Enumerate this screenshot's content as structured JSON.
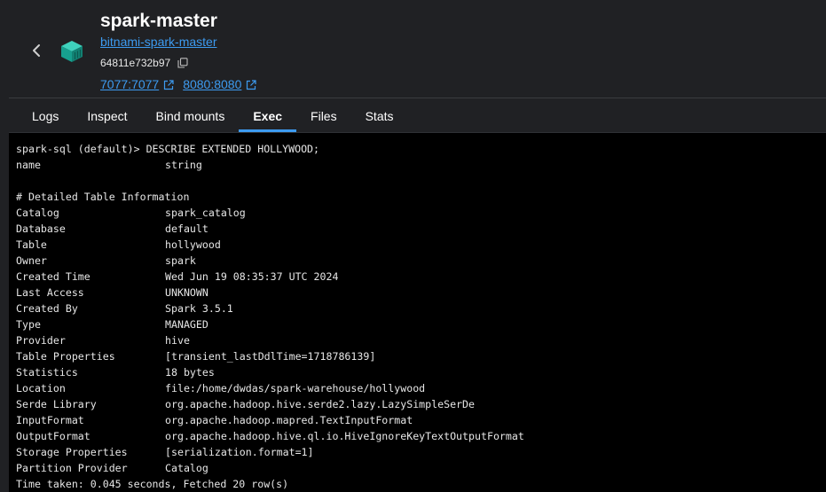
{
  "header": {
    "title": "spark-master",
    "image_link": "bitnami-spark-master",
    "container_id": "64811e732b97",
    "ports": [
      "7077:7077",
      "8080:8080"
    ],
    "back_icon": "chevron-left-icon",
    "container_icon": "container-cube-icon"
  },
  "tabs": [
    {
      "label": "Logs",
      "active": false
    },
    {
      "label": "Inspect",
      "active": false
    },
    {
      "label": "Bind mounts",
      "active": false
    },
    {
      "label": "Exec",
      "active": true
    },
    {
      "label": "Files",
      "active": false
    },
    {
      "label": "Stats",
      "active": false
    }
  ],
  "terminal": {
    "command": "spark-sql (default)> DESCRIBE EXTENDED HOLLYWOOD;",
    "column_row": {
      "name": "name",
      "value": "string"
    },
    "blank": "",
    "section_header": "# Detailed Table Information",
    "rows": [
      {
        "key": "Catalog",
        "value": "spark_catalog"
      },
      {
        "key": "Database",
        "value": "default"
      },
      {
        "key": "Table",
        "value": "hollywood"
      },
      {
        "key": "Owner",
        "value": "spark"
      },
      {
        "key": "Created Time",
        "value": "Wed Jun 19 08:35:37 UTC 2024"
      },
      {
        "key": "Last Access",
        "value": "UNKNOWN"
      },
      {
        "key": "Created By",
        "value": "Spark 3.5.1"
      },
      {
        "key": "Type",
        "value": "MANAGED"
      },
      {
        "key": "Provider",
        "value": "hive"
      },
      {
        "key": "Table Properties",
        "value": "[transient_lastDdlTime=1718786139]"
      },
      {
        "key": "Statistics",
        "value": "18 bytes"
      },
      {
        "key": "Location",
        "value": "file:/home/dwdas/spark-warehouse/hollywood"
      },
      {
        "key": "Serde Library",
        "value": "org.apache.hadoop.hive.serde2.lazy.LazySimpleSerDe"
      },
      {
        "key": "InputFormat",
        "value": "org.apache.hadoop.mapred.TextInputFormat"
      },
      {
        "key": "OutputFormat",
        "value": "org.apache.hadoop.hive.ql.io.HiveIgnoreKeyTextOutputFormat"
      },
      {
        "key": "Storage Properties",
        "value": "[serialization.format=1]"
      },
      {
        "key": "Partition Provider",
        "value": "Catalog"
      }
    ],
    "footer": "Time taken: 0.045 seconds, Fetched 20 row(s)"
  },
  "colors": {
    "background": "#202124",
    "terminal_bg": "#000000",
    "link": "#3d9bf0",
    "accent": "#3d9bf0",
    "container_icon": "#1fb5a3"
  }
}
